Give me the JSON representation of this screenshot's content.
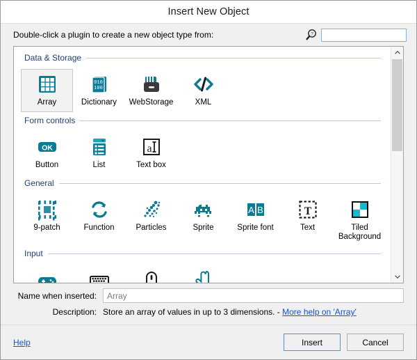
{
  "window": {
    "title": "Insert New Object"
  },
  "topbar": {
    "prompt": "Double-click a plugin to create a new object type from:",
    "search_icon": "search-help-icon",
    "search_value": "",
    "search_placeholder": ""
  },
  "groups": [
    {
      "title": "Data & Storage",
      "items": [
        {
          "label": "Array",
          "icon": "grid-icon",
          "selected": true
        },
        {
          "label": "Dictionary",
          "icon": "books-binary-icon",
          "selected": false
        },
        {
          "label": "WebStorage",
          "icon": "drive-icon",
          "selected": false
        },
        {
          "label": "XML",
          "icon": "code-brackets-icon",
          "selected": false
        }
      ]
    },
    {
      "title": "Form controls",
      "items": [
        {
          "label": "Button",
          "icon": "ok-button-icon",
          "selected": false
        },
        {
          "label": "List",
          "icon": "list-dropdown-icon",
          "selected": false
        },
        {
          "label": "Text box",
          "icon": "text-cursor-icon",
          "selected": false
        }
      ]
    },
    {
      "title": "General",
      "items": [
        {
          "label": "9-patch",
          "icon": "nine-patch-icon",
          "selected": false
        },
        {
          "label": "Function",
          "icon": "loop-arrows-icon",
          "selected": false
        },
        {
          "label": "Particles",
          "icon": "particles-icon",
          "selected": false
        },
        {
          "label": "Sprite",
          "icon": "space-invader-icon",
          "selected": false
        },
        {
          "label": "Sprite font",
          "icon": "ab-letters-icon",
          "selected": false
        },
        {
          "label": "Text",
          "icon": "dashed-t-icon",
          "selected": false
        },
        {
          "label": "Tiled Background",
          "icon": "checker-tile-icon",
          "selected": false
        }
      ]
    },
    {
      "title": "Input",
      "items": [
        {
          "label": "",
          "icon": "gamepad-icon",
          "selected": false
        },
        {
          "label": "",
          "icon": "keyboard-icon",
          "selected": false
        },
        {
          "label": "",
          "icon": "mouse-icon",
          "selected": false
        },
        {
          "label": "",
          "icon": "touch-icon",
          "selected": false
        }
      ]
    }
  ],
  "scrollbar": {
    "up_arrow": "chevron-up-icon",
    "down_arrow": "chevron-down-icon"
  },
  "form": {
    "name_label": "Name when inserted:",
    "name_value": "Array",
    "description_label": "Description:",
    "description_text": "Store an array of values in up to 3 dimensions. - ",
    "description_link": "More help on 'Array'"
  },
  "footer": {
    "help_label": "Help",
    "insert_label": "Insert",
    "cancel_label": "Cancel"
  },
  "colors": {
    "accent_teal": "#0b7b94",
    "link_blue": "#1155cc",
    "group_title": "#1f3f77",
    "focus_border": "#4a96dd"
  }
}
